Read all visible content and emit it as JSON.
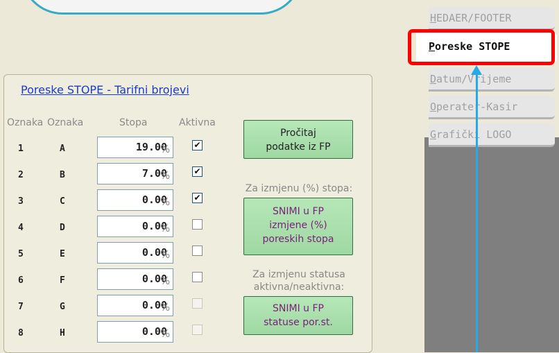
{
  "panel": {
    "title": "Poreske STOPE - Tarifni brojevi"
  },
  "headers": {
    "oznaka1": "Oznaka",
    "oznaka2": "Oznaka",
    "stopa": "Stopa",
    "aktivna": "Aktivna"
  },
  "rows": [
    {
      "num": "1",
      "letter": "A",
      "rate": "19.00",
      "pct": "%",
      "active": "checked"
    },
    {
      "num": "2",
      "letter": "B",
      "rate": "7.00",
      "pct": "%",
      "active": "checked"
    },
    {
      "num": "3",
      "letter": "C",
      "rate": "0.00",
      "pct": "%",
      "active": "checked"
    },
    {
      "num": "4",
      "letter": "D",
      "rate": "0.00",
      "pct": "%",
      "active": "unchecked"
    },
    {
      "num": "5",
      "letter": "E",
      "rate": "0.00",
      "pct": "%",
      "active": "unchecked"
    },
    {
      "num": "6",
      "letter": "F",
      "rate": "0.00",
      "pct": "%",
      "active": "unchecked"
    },
    {
      "num": "7",
      "letter": "G",
      "rate": "0.00",
      "pct": "%",
      "active": "disabled"
    },
    {
      "num": "8",
      "letter": "H",
      "rate": "0.00",
      "pct": "%",
      "active": "disabled"
    }
  ],
  "buttons": {
    "read": [
      "Pročitaj",
      "podatke iz FP"
    ],
    "save_rates": [
      "SNIMI u FP",
      "izmjene (%)",
      "poreskih stopa"
    ],
    "save_status": [
      "SNIMI u FP",
      "statuse por.st."
    ]
  },
  "notes": {
    "rates": "Za izmjenu (%) stopa:",
    "status": [
      "Za izmjenu statusa",
      "aktivna/neaktivna:"
    ]
  },
  "tabs": [
    {
      "label": "HEDAER/FOOTER",
      "ul": "H",
      "rest": "EDAER/FOOTER"
    },
    {
      "label": "Poreske STOPE",
      "ul": "P",
      "rest": "oreske STOPE"
    },
    {
      "label": "Datum/Vrijeme",
      "ul": "D",
      "rest": "atum/Vrijeme"
    },
    {
      "label": "Operater-Kasir",
      "ul": "O",
      "rest": "perater-Kasir"
    },
    {
      "label": "Grafički LOGO",
      "ul": "G",
      "rest": "rafički LOGO"
    }
  ],
  "colors": {
    "highlight": "#ff0000",
    "arrow": "#2aa7e5",
    "button_text_purple": "#7a1f7a"
  }
}
